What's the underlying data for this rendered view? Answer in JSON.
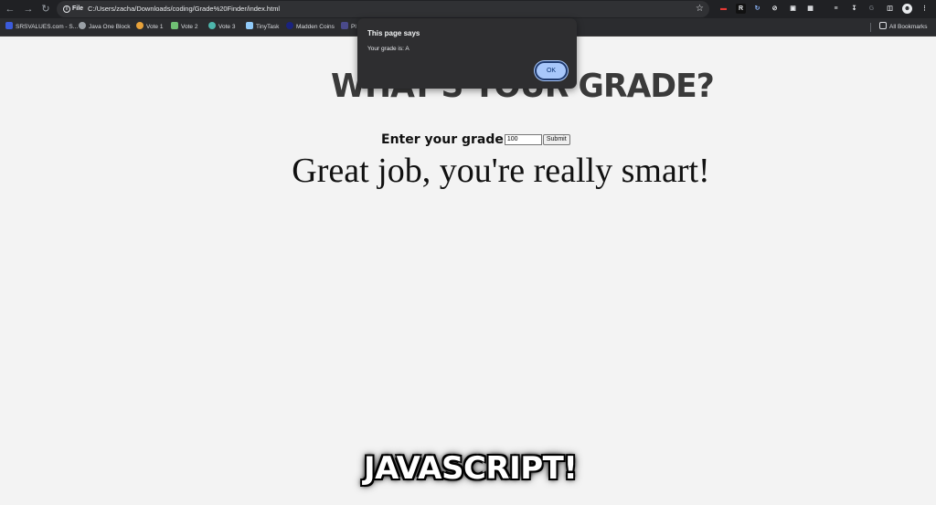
{
  "browser": {
    "url_chip": "File",
    "url": "C:/Users/zacha/Downloads/coding/Grade%20Finder/index.html",
    "bookmarks": [
      {
        "label": "SRSVALUES.com - S..."
      },
      {
        "label": "Java One Block"
      },
      {
        "label": "Vote 1"
      },
      {
        "label": "Vote 2"
      },
      {
        "label": "Vote 3"
      },
      {
        "label": "TinyTask"
      },
      {
        "label": "Madden Coins"
      },
      {
        "label": "Pl"
      }
    ],
    "all_bookmarks": "All Bookmarks"
  },
  "page": {
    "title": "WHAT'S YOUR GRADE?",
    "form_label": "Enter your grade",
    "input_value": "100",
    "submit_label": "Submit",
    "result_message": "Great job, you're really smart!"
  },
  "dialog": {
    "title": "This page says",
    "message": "Your grade is: A",
    "ok_label": "OK"
  },
  "overlay": {
    "caption": "JAVASCRIPT!"
  },
  "colors": {
    "chrome_dark": "#202124",
    "page_bg": "#f3f3f3",
    "ok_button": "#a8c7fa"
  }
}
